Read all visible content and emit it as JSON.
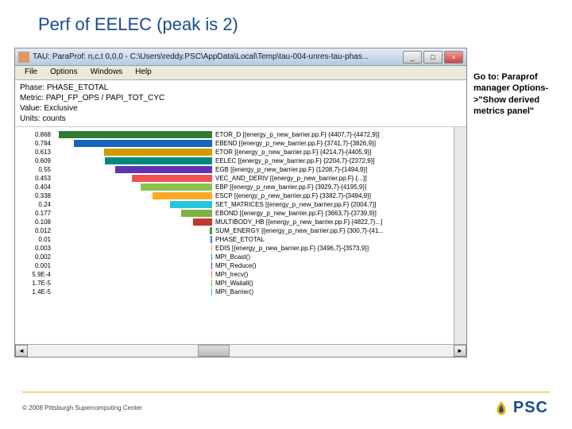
{
  "slide": {
    "title": "Perf of EELEC (peak is 2)"
  },
  "note": {
    "text": "Go to: Paraprof manager Options->\"Show derived metrics panel\""
  },
  "footer": {
    "copyright": "© 2008 Pittsburgh Supercomputing Center",
    "logo_text": "PSC"
  },
  "window": {
    "title": "TAU: ParaProf: n,c,t 0,0,0 - C:\\Users\\reddy.PSC\\AppData\\Local\\Temp\\tau-004-unres-tau-phas...",
    "menu": [
      "File",
      "Options",
      "Windows",
      "Help"
    ],
    "meta": {
      "phase": "Phase: PHASE_ETOTAL",
      "metric": "Metric: PAPI_FP_OPS / PAPI_TOT_CYC",
      "value": "Value: Exclusive",
      "units": "Units: counts"
    }
  },
  "chart_data": {
    "type": "bar",
    "title": "",
    "xlabel": "",
    "ylabel": "",
    "xlim": [
      0,
      0.9
    ],
    "series": [
      {
        "value": 0.868,
        "color": "#2e7d32",
        "label": "ETOR_D [{energy_p_new_barrier.pp.F} {4407,7}-{4472,9}]"
      },
      {
        "value": 0.784,
        "color": "#1565c0",
        "label": "EBEND [{energy_p_new_barrier.pp.F} {3741,7}-{3826,9}]"
      },
      {
        "value": 0.613,
        "color": "#d19a00",
        "label": "ETOR [{energy_p_new_barrier.pp.F} {4214,7}-{4405,9}]"
      },
      {
        "value": 0.609,
        "color": "#00897b",
        "label": "EELEC [{energy_p_new_barrier.pp.F} {2204,7}-{2372,9}]"
      },
      {
        "value": 0.55,
        "color": "#5e35b1",
        "label": "EGB [{energy_p_new_barrier.pp.F} {1208,7}-{1494,9}]"
      },
      {
        "value": 0.453,
        "color": "#ef5350",
        "label": "VEC_AND_DERIV [{energy_p_new_barrier.pp.F} {...}]"
      },
      {
        "value": 0.404,
        "color": "#8bc34a",
        "label": "EBP [{energy_p_new_barrier.pp.F} {3929,7}-{4195,9}]"
      },
      {
        "value": 0.338,
        "color": "#ffa726",
        "label": "ESCP [{energy_p_new_barrier.pp.F} {3382,7}-{3494,9}]"
      },
      {
        "value": 0.24,
        "color": "#26c6da",
        "label": "SET_MATRICES [{energy_p_new_barrier.pp.F} {2004,7}]"
      },
      {
        "value": 0.177,
        "color": "#7cb342",
        "label": "EBOND [{energy_p_new_barrier.pp.F} {3663,7}-{3739,9}]"
      },
      {
        "value": 0.108,
        "color": "#c0392b",
        "label": "MULTIBODY_HB [{energy_p_new_barrier.pp.F} {4822,7}...]"
      },
      {
        "value": 0.012,
        "color": "#43a047",
        "label": "SUM_ENERGY [{energy_p_new_barrier.pp.F} {300,7}-{41..."
      },
      {
        "value": 0.01,
        "color": "#1e88e5",
        "label": "PHASE_ETOTAL"
      },
      {
        "value": 0.003,
        "color": "#f9a825",
        "label": "EDIS [{energy_p_new_barrier.pp.F} {3496,7}-{3573,9}]"
      },
      {
        "value": 0.002,
        "color": "#00acc1",
        "label": "MPI_Bcast()"
      },
      {
        "value": 0.001,
        "color": "#8e24aa",
        "label": "MPI_Reduce()"
      },
      {
        "value": 0.00059,
        "color": "#ff7043",
        "label": "MPI_Irecv()"
      },
      {
        "value": 1.7e-05,
        "color": "#66bb6a",
        "label": "MPI_Waitall()"
      },
      {
        "value": 1.4e-05,
        "color": "#42a5f5",
        "label": "MPI_Barrier()"
      }
    ]
  }
}
